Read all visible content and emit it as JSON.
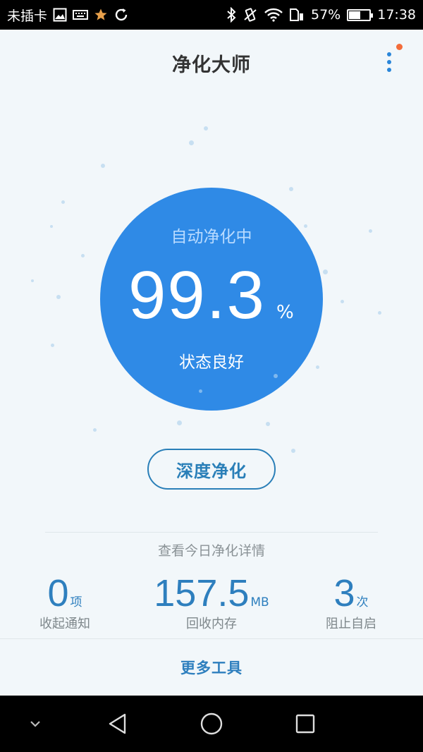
{
  "status_bar": {
    "carrier": "未插卡",
    "battery_percent": "57%",
    "battery_level": 0.57,
    "time": "17:38",
    "icons_left": [
      "image-icon",
      "keyboard-icon",
      "star-icon",
      "sync-icon"
    ],
    "icons_right": [
      "bluetooth-icon",
      "vibrate-icon",
      "wifi-icon",
      "sim-icon",
      "battery-icon"
    ]
  },
  "header": {
    "title": "净化大师"
  },
  "main": {
    "status_text": "自动净化中",
    "score": "99.3",
    "score_unit": "%",
    "state_text": "状态良好",
    "deep_clean_label": "深度净化",
    "details_link": "查看今日净化详情"
  },
  "stats": [
    {
      "value": "0",
      "unit": "项",
      "label": "收起通知"
    },
    {
      "value": "157.5",
      "unit": "MB",
      "label": "回收内存"
    },
    {
      "value": "3",
      "unit": "次",
      "label": "阻止自启"
    }
  ],
  "footer": {
    "more_tools_label": "更多工具"
  },
  "colors": {
    "accent": "#2f8ae6",
    "text_blue": "#2e7fbe",
    "badge": "#f36c3a"
  }
}
